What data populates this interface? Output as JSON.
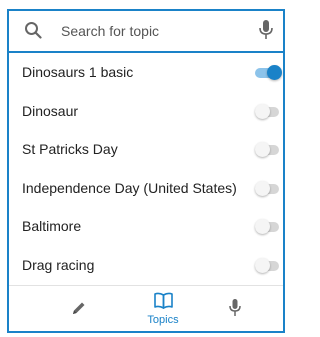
{
  "search": {
    "placeholder": "Search for topic",
    "value": "",
    "icon": "search-icon",
    "mic_icon": "microphone-icon"
  },
  "topics": [
    {
      "label": "Dinosaurs 1 basic",
      "enabled": true
    },
    {
      "label": "Dinosaur",
      "enabled": false
    },
    {
      "label": "St Patricks Day",
      "enabled": false
    },
    {
      "label": "Independence Day (United States)",
      "enabled": false
    },
    {
      "label": "Baltimore",
      "enabled": false
    },
    {
      "label": "Drag racing",
      "enabled": false
    }
  ],
  "bottom_nav": {
    "items": [
      {
        "icon": "pencil-icon",
        "label": ""
      },
      {
        "icon": "book-icon",
        "label": "Topics",
        "active": true
      },
      {
        "icon": "microphone-icon",
        "label": ""
      }
    ]
  },
  "colors": {
    "accent": "#1a82c8",
    "toggle_on_track": "#8cc3ea",
    "toggle_off_track": "#d6d6d6",
    "icon_gray": "#666666"
  }
}
